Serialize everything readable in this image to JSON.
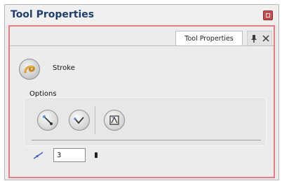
{
  "window": {
    "title": "Tool Properties"
  },
  "tab": {
    "label": "Tool Properties"
  },
  "stroke": {
    "label": "Stroke"
  },
  "options": {
    "label": "Options"
  },
  "thickness": {
    "value": "3"
  },
  "icons": {
    "stroke": "stroke-brush-icon",
    "close": "close-icon",
    "pin": "pin-icon",
    "close_tab": "close-panel-icon",
    "option1": "auto-flatten-icon",
    "option2": "auto-fill-icon",
    "option3": "stroke-properties-icon",
    "thickness": "line-thickness-icon"
  },
  "colors": {
    "title_text": "#1e3f6e",
    "panel_border": "#e47d86",
    "close_button": "#cf4b4b"
  }
}
